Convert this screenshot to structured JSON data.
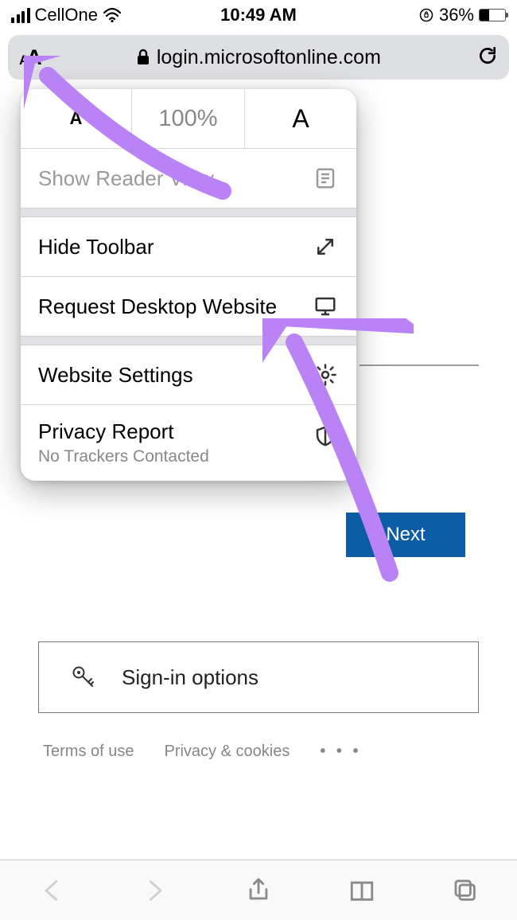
{
  "status": {
    "carrier": "CellOne",
    "time": "10:49 AM",
    "battery_pct": "36%"
  },
  "address_bar": {
    "text_size_label": "aA",
    "url": "login.microsoftonline.com"
  },
  "popover": {
    "zoom_smaller": "A",
    "zoom_value": "100%",
    "zoom_larger": "A",
    "reader_view": "Show Reader View",
    "hide_toolbar": "Hide Toolbar",
    "request_desktop": "Request Desktop Website",
    "website_settings": "Website Settings",
    "privacy_report": "Privacy Report",
    "privacy_sub": "No Trackers Contacted"
  },
  "page_content": {
    "next_button": "Next",
    "signin_options": "Sign-in options"
  },
  "footer": {
    "terms": "Terms of use",
    "privacy": "Privacy & cookies",
    "more": "• • •"
  }
}
